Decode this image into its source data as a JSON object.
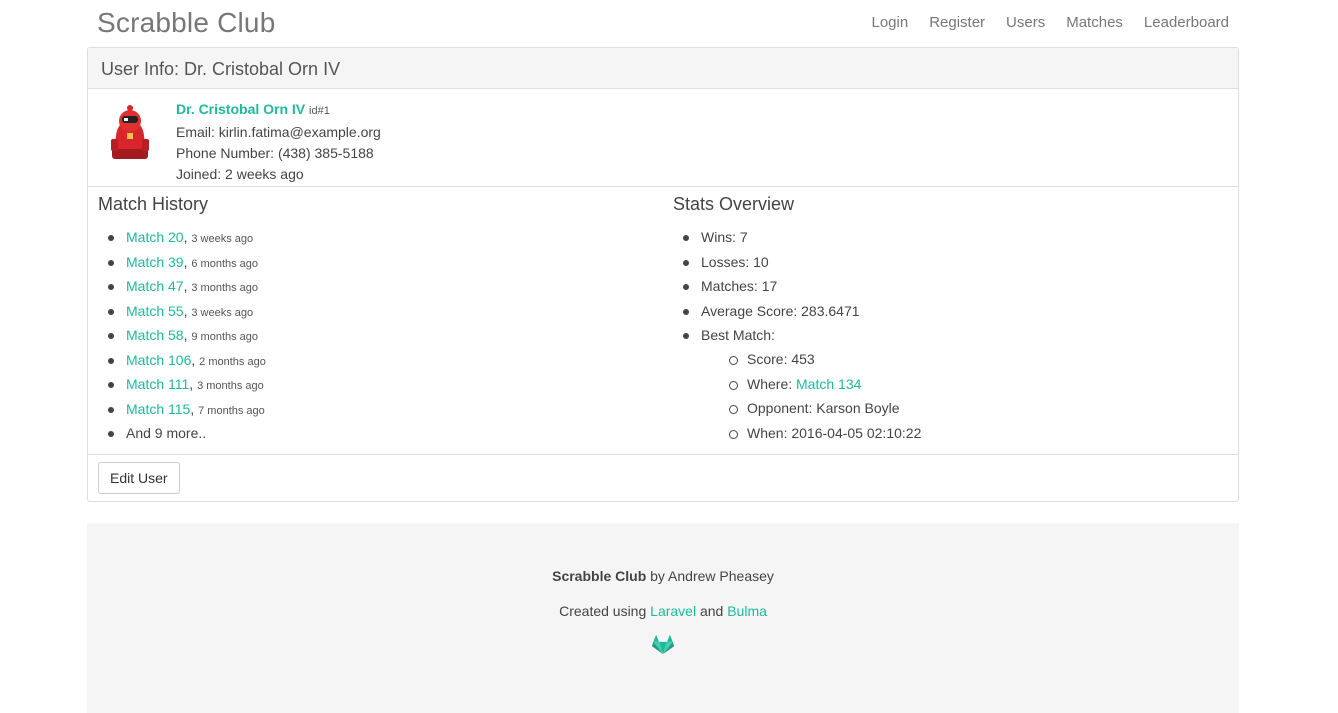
{
  "nav": {
    "brand": "Scrabble Club",
    "links": [
      "Login",
      "Register",
      "Users",
      "Matches",
      "Leaderboard"
    ]
  },
  "panel": {
    "heading": "User Info: Dr. Cristobal Orn IV"
  },
  "user": {
    "name": "Dr. Cristobal Orn IV",
    "id_label": "id#1",
    "email": "Email: kirlin.fatima@example.org",
    "phone": "Phone Number: (438) 385-5188",
    "joined": "Joined: 2 weeks ago"
  },
  "match_history": {
    "title": "Match History",
    "matches": [
      {
        "label": "Match 20",
        "ago": "3 weeks ago"
      },
      {
        "label": "Match 39",
        "ago": "6 months ago"
      },
      {
        "label": "Match 47",
        "ago": "3 months ago"
      },
      {
        "label": "Match 55",
        "ago": "3 weeks ago"
      },
      {
        "label": "Match 58",
        "ago": "9 months ago"
      },
      {
        "label": "Match 106",
        "ago": "2 months ago"
      },
      {
        "label": "Match 111",
        "ago": "3 months ago"
      },
      {
        "label": "Match 115",
        "ago": "7 months ago"
      }
    ],
    "more": "And 9 more.."
  },
  "stats": {
    "title": "Stats Overview",
    "wins": "Wins: 7",
    "losses": "Losses: 10",
    "matches": "Matches: 17",
    "average": "Average Score: 283.6471",
    "best_label": "Best Match:",
    "best": {
      "score": "Score: 453",
      "where_label": "Where:",
      "where_link": "Match 134",
      "opponent": "Opponent: Karson Boyle",
      "when": "When: 2016-04-05 02:10:22"
    }
  },
  "actions": {
    "edit": "Edit User"
  },
  "footer": {
    "brand": "Scrabble Club",
    "by": "by Andrew Pheasey",
    "created": "Created using",
    "laravel": "Laravel",
    "and": "and",
    "bulma": "Bulma",
    "logo_icon": "gitlab-icon"
  },
  "colors": {
    "accent": "#1abc9c",
    "avatar": "#d9262c"
  }
}
